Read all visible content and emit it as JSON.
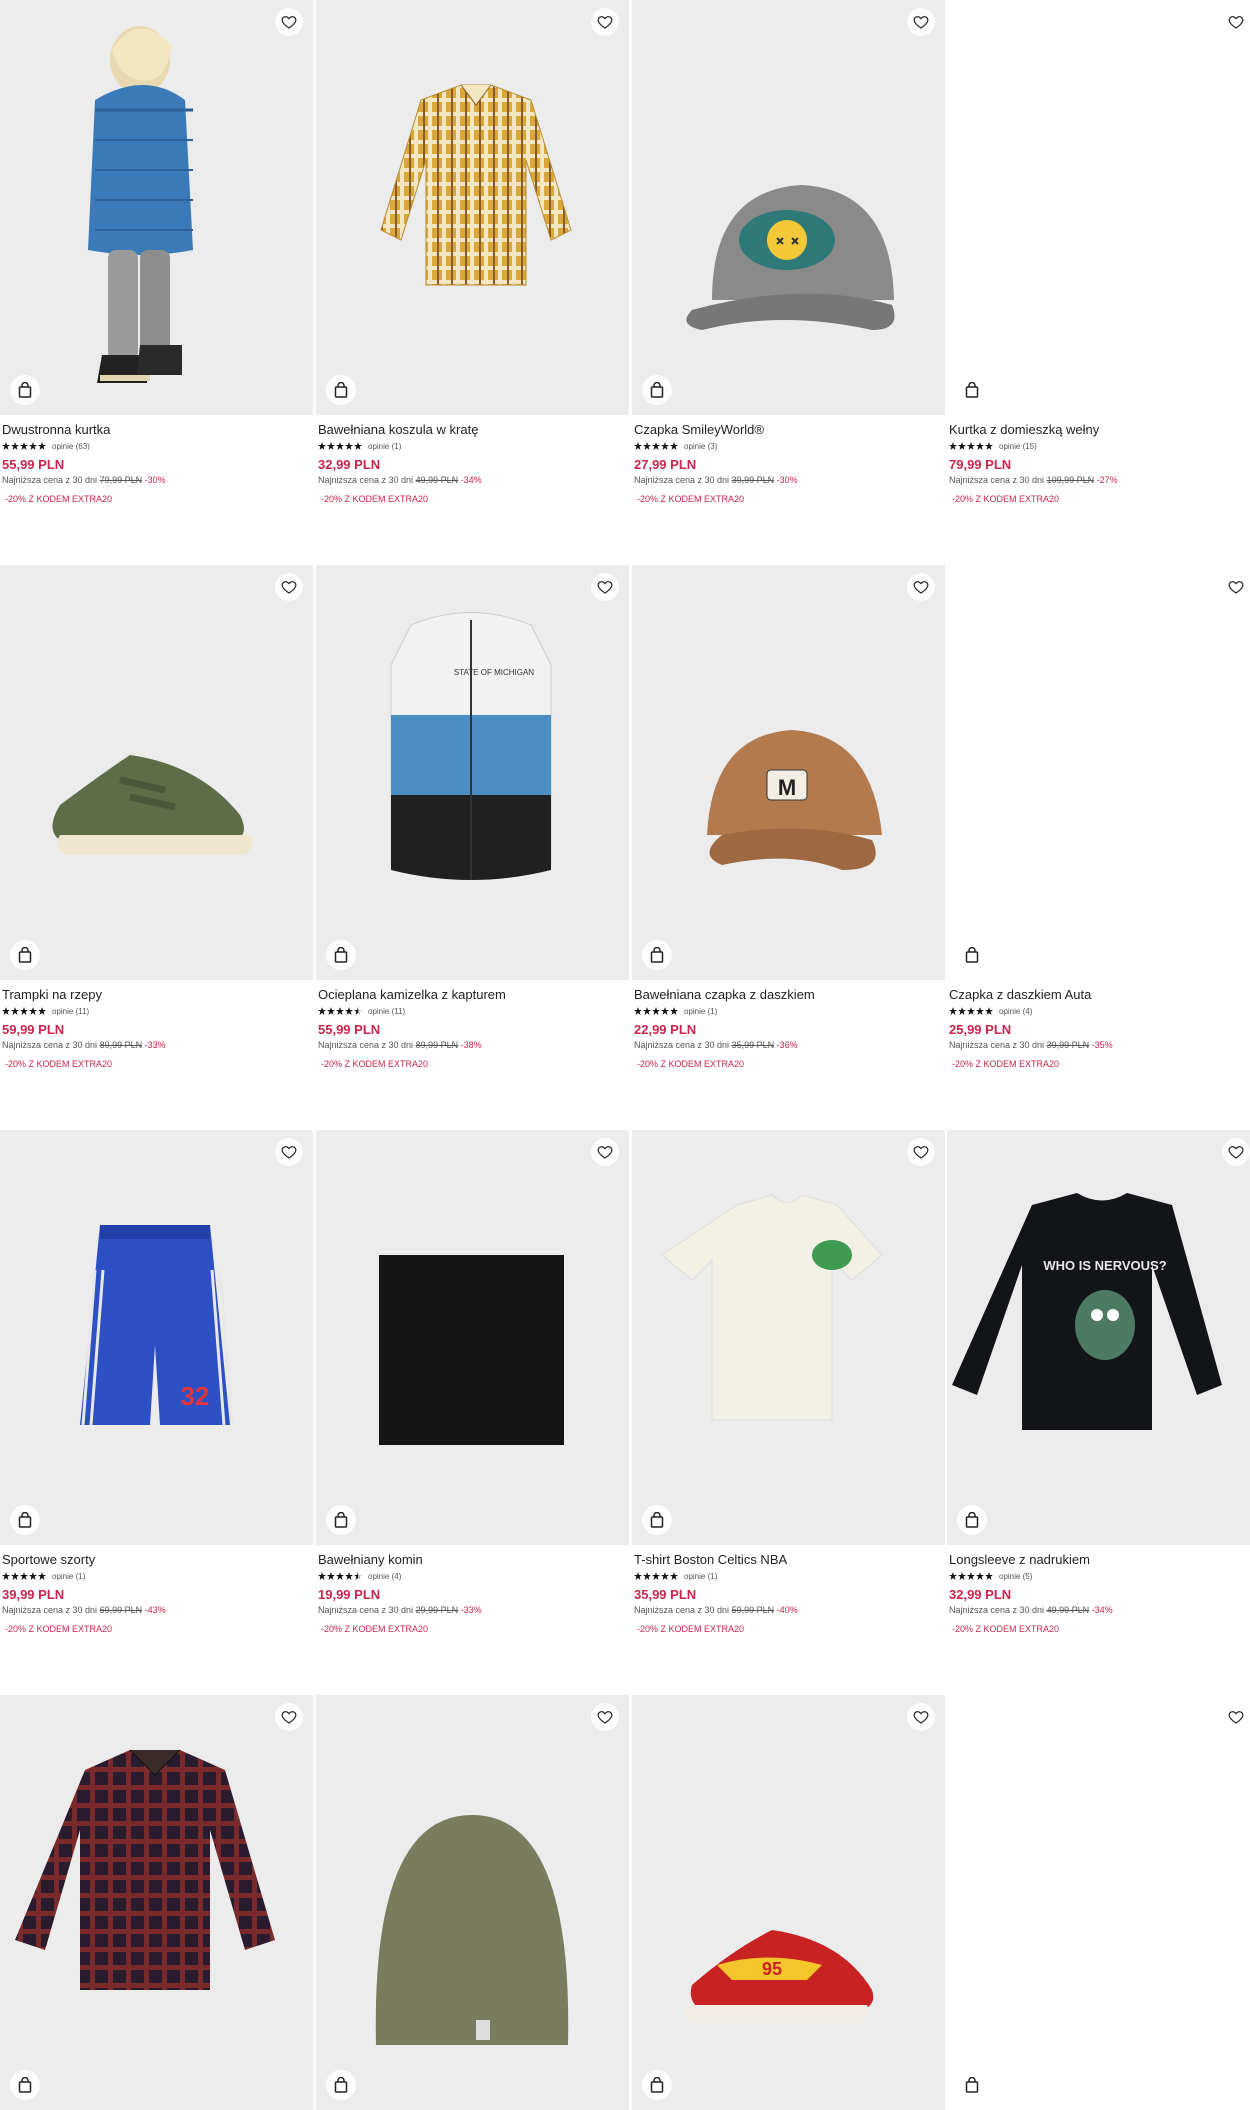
{
  "products": [
    {
      "name": "Dwustronna kurtka",
      "rating_stars": 5,
      "reviews": "opinie (63)",
      "price": "55,99 PLN",
      "lowest_label": "Najniższa cena z 30 dni",
      "old_price": "79,99 PLN",
      "discount": "-30%",
      "promo": "-20% Z KODEM EXTRA20",
      "art": "child-jacket-image"
    },
    {
      "name": "Bawełniana koszula w kratę",
      "rating_stars": 5,
      "reviews": "opinie (1)",
      "price": "32,99 PLN",
      "lowest_label": "Najniższa cena z 30 dni",
      "old_price": "49,99 PLN",
      "discount": "-34%",
      "promo": "-20% Z KODEM EXTRA20",
      "art": "plaid-shirt-image"
    },
    {
      "name": "Czapka SmileyWorld®",
      "rating_stars": 5,
      "reviews": "opinie (3)",
      "price": "27,99 PLN",
      "lowest_label": "Najniższa cena z 30 dni",
      "old_price": "39,99 PLN",
      "discount": "-30%",
      "promo": "-20% Z KODEM EXTRA20",
      "art": "grey-cap-image"
    },
    {
      "name": "Kurtka z domieszką wełny",
      "rating_stars": 5,
      "reviews": "opinie (15)",
      "price": "79,99 PLN",
      "lowest_label": "Najniższa cena z 30 dni",
      "old_price": "109,99 PLN",
      "discount": "-27%",
      "promo": "-20% Z KODEM EXTRA20",
      "art": "blank-image"
    },
    {
      "name": "Trampki na rzepy",
      "rating_stars": 5,
      "reviews": "opinie (11)",
      "price": "59,99 PLN",
      "lowest_label": "Najniższa cena z 30 dni",
      "old_price": "89,99 PLN",
      "discount": "-33%",
      "promo": "-20% Z KODEM EXTRA20",
      "art": "green-sneaker-image"
    },
    {
      "name": "Ocieplana kamizelka z kapturem",
      "rating_stars": 4.5,
      "reviews": "opinie (11)",
      "price": "55,99 PLN",
      "lowest_label": "Najniższa cena z 30 dni",
      "old_price": "89,99 PLN",
      "discount": "-38%",
      "promo": "-20% Z KODEM EXTRA20",
      "art": "puffer-vest-image"
    },
    {
      "name": "Bawełniana czapka z daszkiem",
      "rating_stars": 5,
      "reviews": "opinie (1)",
      "price": "22,99 PLN",
      "lowest_label": "Najniższa cena z 30 dni",
      "old_price": "35,99 PLN",
      "discount": "-36%",
      "promo": "-20% Z KODEM EXTRA20",
      "art": "brown-cap-image"
    },
    {
      "name": "Czapka z daszkiem Auta",
      "rating_stars": 5,
      "reviews": "opinie (4)",
      "price": "25,99 PLN",
      "lowest_label": "Najniższa cena z 30 dni",
      "old_price": "39,99 PLN",
      "discount": "-35%",
      "promo": "-20% Z KODEM EXTRA20",
      "art": "blank-image"
    },
    {
      "name": "Sportowe szorty",
      "rating_stars": 5,
      "reviews": "opinie (1)",
      "price": "39,99 PLN",
      "lowest_label": "Najniższa cena z 30 dni",
      "old_price": "69,99 PLN",
      "discount": "-43%",
      "promo": "-20% Z KODEM EXTRA20",
      "art": "blue-shorts-image"
    },
    {
      "name": "Bawełniany komin",
      "rating_stars": 4.5,
      "reviews": "opinie (4)",
      "price": "19,99 PLN",
      "lowest_label": "Najniższa cena z 30 dni",
      "old_price": "29,99 PLN",
      "discount": "-33%",
      "promo": "-20% Z KODEM EXTRA20",
      "art": "black-snood-image"
    },
    {
      "name": "T-shirt Boston Celtics NBA",
      "rating_stars": 5,
      "reviews": "opinie (1)",
      "price": "35,99 PLN",
      "lowest_label": "Najniższa cena z 30 dni",
      "old_price": "59,99 PLN",
      "discount": "-40%",
      "promo": "-20% Z KODEM EXTRA20",
      "art": "white-tshirt-image"
    },
    {
      "name": "Longsleeve z nadrukiem",
      "rating_stars": 5,
      "reviews": "opinie (5)",
      "price": "32,99 PLN",
      "lowest_label": "Najniższa cena z 30 dni",
      "old_price": "49,99 PLN",
      "discount": "-34%",
      "promo": "-20% Z KODEM EXTRA20",
      "art": "black-longsleeve-image"
    },
    {
      "name": "",
      "art": "flannel-shirt-image"
    },
    {
      "name": "",
      "art": "green-beanie-image"
    },
    {
      "name": "",
      "art": "red-sneaker-image"
    },
    {
      "name": "",
      "art": "blank-image"
    }
  ],
  "print_text": {
    "longsleeve": "WHO IS NERVOUS?",
    "vest": "STATE OF MICHIGAN",
    "shorts_number": "32",
    "sneaker_number": "95",
    "cap_letter": "M"
  },
  "icons": {
    "wishlist": "heart-icon",
    "cart": "shopping-bag-icon",
    "rating": "star-icon"
  },
  "colors": {
    "price": "#c8254c",
    "image_bg": "#ececed"
  }
}
